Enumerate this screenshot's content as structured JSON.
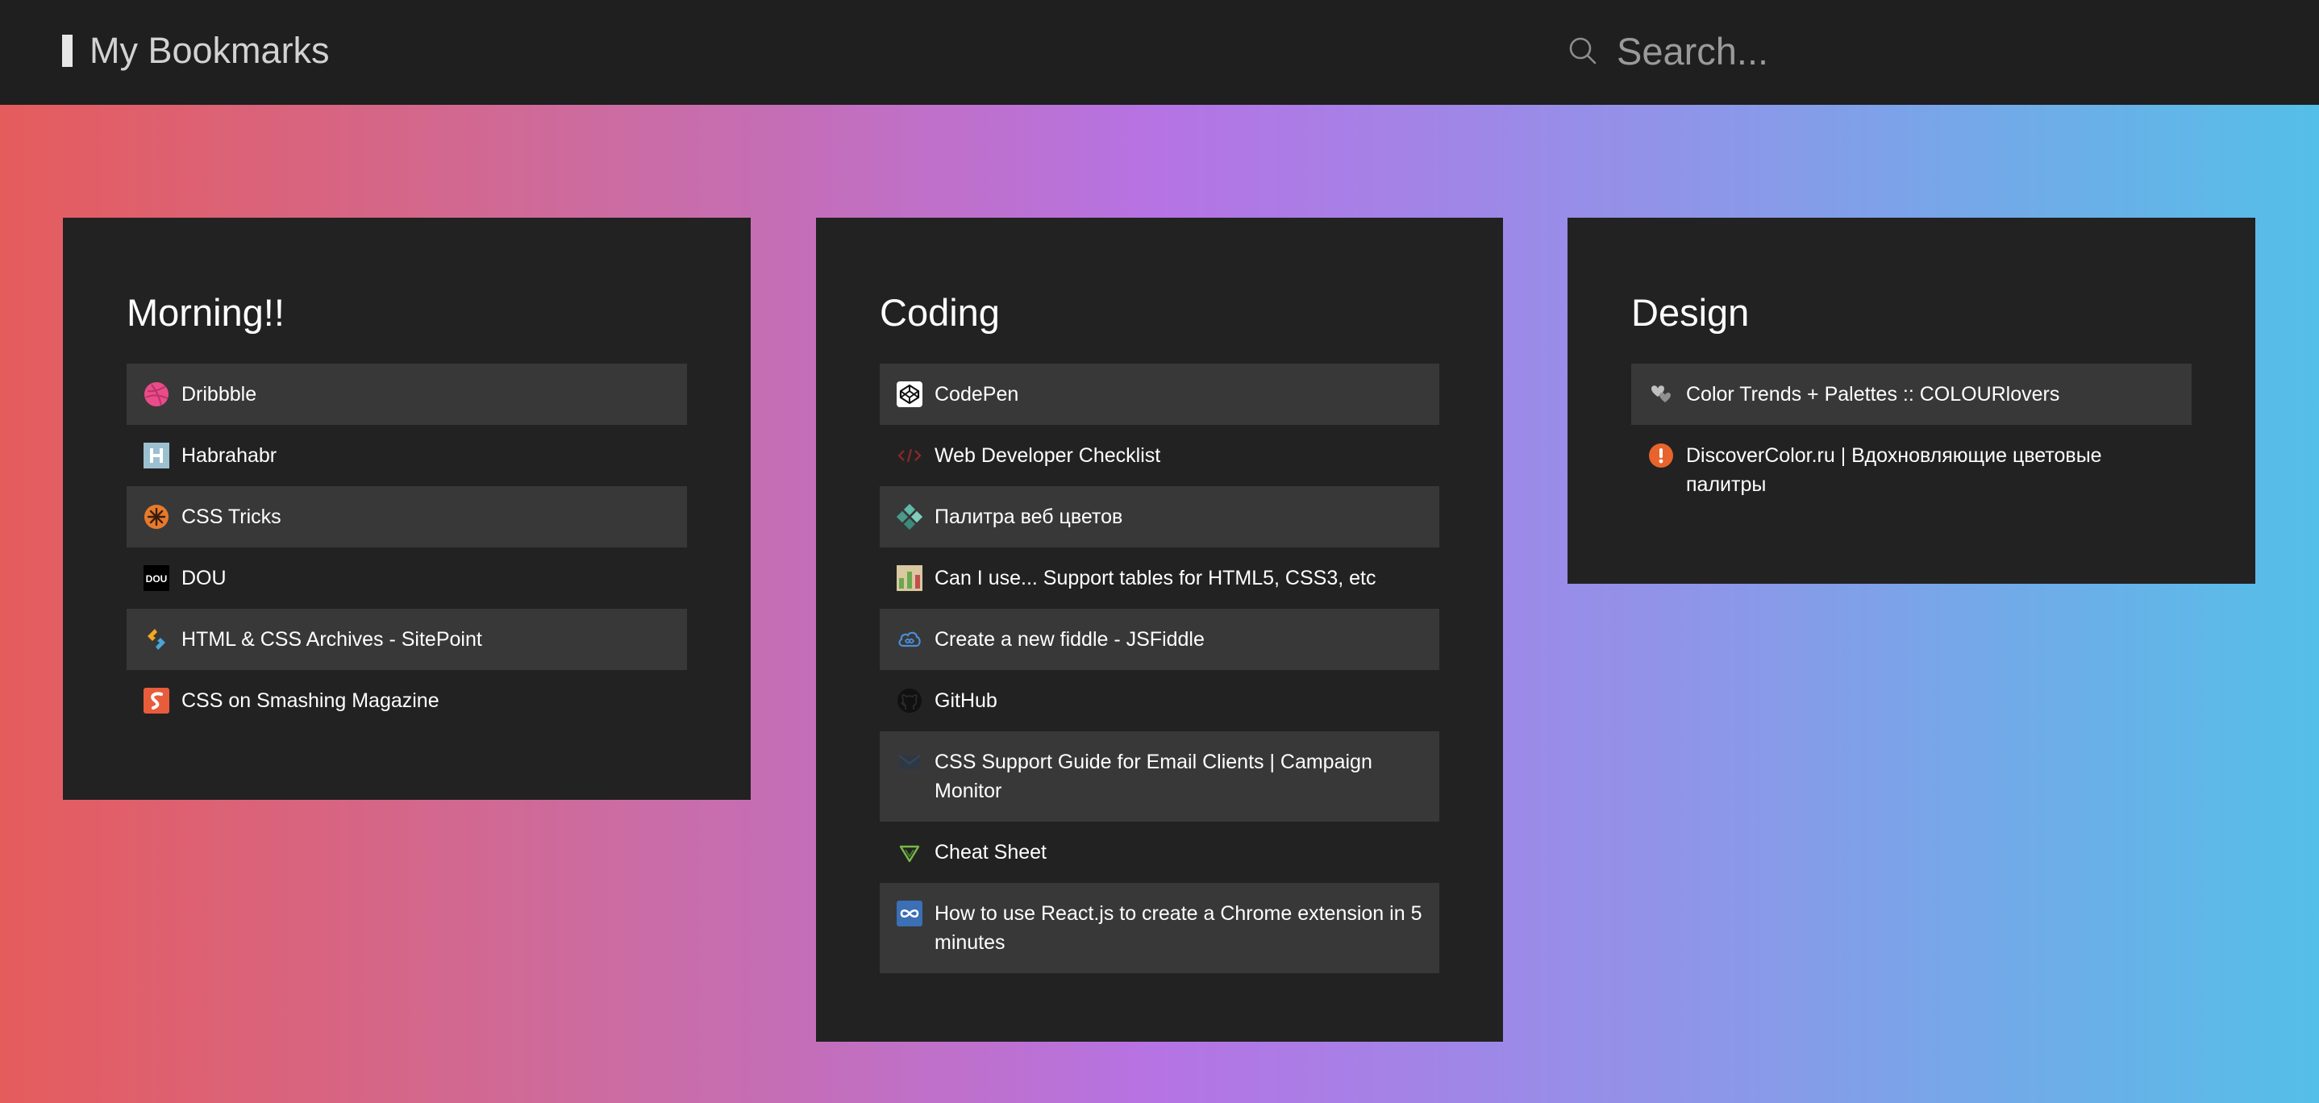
{
  "header": {
    "title": "My Bookmarks",
    "search_placeholder": "Search..."
  },
  "colors": {
    "topbar": "#1f1f1f",
    "card": "#222222",
    "row_shade": "#383838",
    "gradient": [
      "#e55c5c",
      "#cd6b9e",
      "#b673e4",
      "#8b98e9",
      "#54bfe8"
    ]
  },
  "groups": [
    {
      "title": "Morning!!",
      "items": [
        {
          "label": "Dribbble",
          "icon": "dribbble-icon"
        },
        {
          "label": "Habrahabr",
          "icon": "habrahabr-icon"
        },
        {
          "label": "CSS Tricks",
          "icon": "css-tricks-icon"
        },
        {
          "label": "DOU",
          "icon": "dou-icon"
        },
        {
          "label": "HTML & CSS Archives - SitePoint",
          "icon": "sitepoint-icon"
        },
        {
          "label": "CSS on Smashing Magazine",
          "icon": "smashing-magazine-icon"
        }
      ]
    },
    {
      "title": "Coding",
      "items": [
        {
          "label": "CodePen",
          "icon": "codepen-icon"
        },
        {
          "label": "Web Developer Checklist",
          "icon": "code-brackets-icon"
        },
        {
          "label": "Палитра веб цветов",
          "icon": "palette-icon"
        },
        {
          "label": "Can I use... Support tables for HTML5, CSS3, etc",
          "icon": "caniuse-icon"
        },
        {
          "label": "Create a new fiddle - JSFiddle",
          "icon": "jsfiddle-icon"
        },
        {
          "label": "GitHub",
          "icon": "github-icon"
        },
        {
          "label": "CSS Support Guide for Email Clients | Campaign Monitor",
          "icon": "campaign-monitor-icon"
        },
        {
          "label": "Cheat Sheet",
          "icon": "cheat-sheet-icon"
        },
        {
          "label": "How to use React.js to create a Chrome extension in 5 minutes",
          "icon": "infinity-icon"
        }
      ]
    },
    {
      "title": "Design",
      "items": [
        {
          "label": "Color Trends + Palettes :: COLOURlovers",
          "icon": "colourlovers-icon"
        },
        {
          "label": "DiscoverColor.ru | Вдохновляющие цветовые палитры",
          "icon": "discovercolor-icon"
        }
      ]
    }
  ]
}
